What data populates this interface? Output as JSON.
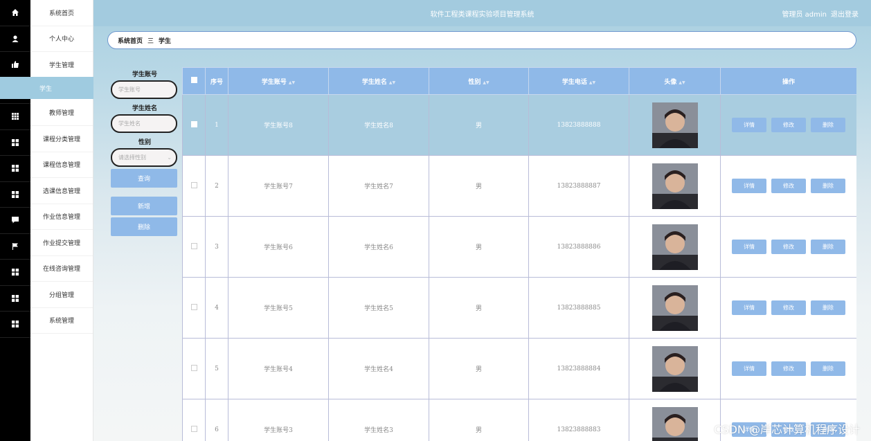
{
  "app": {
    "title": "软件工程类课程实验项目管理系统"
  },
  "user": {
    "label": "管理员 admin",
    "logout": "退出登录"
  },
  "breadcrumb": {
    "home": "系统首页",
    "sep": "三",
    "current": "学生"
  },
  "menu": {
    "items": [
      "系统首页",
      "个人中心",
      "学生管理",
      "教师管理",
      "课程分类管理",
      "课程信息管理",
      "选课信息管理",
      "作业信息管理",
      "作业提交管理",
      "在线咨询管理",
      "分组管理",
      "系统管理"
    ],
    "sub_item": "学生"
  },
  "filters": {
    "account_label": "学生账号",
    "account_placeholder": "学生账号",
    "name_label": "学生姓名",
    "name_placeholder": "学生姓名",
    "gender_label": "性别",
    "gender_placeholder": "请选择性别",
    "search_button": "查询",
    "add_button": "新增",
    "delete_button": "删除"
  },
  "table": {
    "headers": [
      "序号",
      "学生账号",
      "学生姓名",
      "性别",
      "学生电话",
      "头像",
      "操作"
    ],
    "ops": {
      "detail": "详情",
      "edit": "修改",
      "delete": "删除"
    },
    "rows": [
      {
        "index": "1",
        "account": "学生账号8",
        "name": "学生姓名8",
        "gender": "男",
        "phone": "13823888888",
        "selected": true
      },
      {
        "index": "2",
        "account": "学生账号7",
        "name": "学生姓名7",
        "gender": "男",
        "phone": "13823888887",
        "selected": false
      },
      {
        "index": "3",
        "account": "学生账号6",
        "name": "学生姓名6",
        "gender": "男",
        "phone": "13823888886",
        "selected": false
      },
      {
        "index": "4",
        "account": "学生账号5",
        "name": "学生姓名5",
        "gender": "男",
        "phone": "13823888885",
        "selected": false
      },
      {
        "index": "5",
        "account": "学生账号4",
        "name": "学生姓名4",
        "gender": "男",
        "phone": "13823888884",
        "selected": false
      },
      {
        "index": "6",
        "account": "学生账号3",
        "name": "学生姓名3",
        "gender": "男",
        "phone": "13823888883",
        "selected": false
      }
    ]
  },
  "watermark": "CSDN @岸芯计算机程序设计",
  "colors": {
    "accent": "#8fb9e8",
    "topbar": "#a3cbdf",
    "selected_row": "#a9cde0",
    "rail": "#000000"
  }
}
